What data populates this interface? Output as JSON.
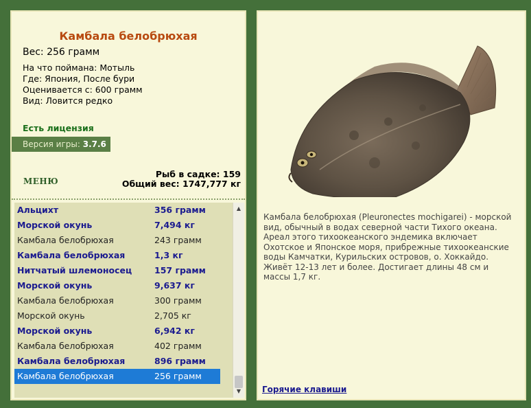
{
  "fish": {
    "name": "Камбала белобрюхая",
    "weight": "Вес: 256 грамм",
    "caught_on": "На что поймана: Мотыль",
    "where": "Где: Япония, После бури",
    "rated_from": "Оценивается с: 600 грамм",
    "kind": "Вид: Ловится редко"
  },
  "license": "Есть лицензия",
  "version": {
    "label": "Версия игры:",
    "number": "3.7.6"
  },
  "menu_label": "МЕНЮ",
  "stats": {
    "in_cage": "Рыб в садке: 159",
    "total_weight": "Общий вес: 1747,777 кг"
  },
  "catch_list": [
    {
      "name": "Альцихт",
      "weight": "356 грамм",
      "style": "bold"
    },
    {
      "name": "Морской окунь",
      "weight": "7,494 кг",
      "style": "bold"
    },
    {
      "name": "Камбала белобрюхая",
      "weight": "243 грамм",
      "style": "plain"
    },
    {
      "name": "Камбала белобрюхая",
      "weight": "1,3 кг",
      "style": "bold"
    },
    {
      "name": "Нитчатый шлемоносец",
      "weight": "157 грамм",
      "style": "bold"
    },
    {
      "name": "Морской окунь",
      "weight": "9,637 кг",
      "style": "bold"
    },
    {
      "name": "Камбала белобрюхая",
      "weight": "300 грамм",
      "style": "plain"
    },
    {
      "name": "Морской окунь",
      "weight": "2,705 кг",
      "style": "plain"
    },
    {
      "name": "Морской окунь",
      "weight": "6,942 кг",
      "style": "bold"
    },
    {
      "name": "Камбала белобрюхая",
      "weight": "402 грамм",
      "style": "plain"
    },
    {
      "name": "Камбала белобрюхая",
      "weight": "896 грамм",
      "style": "bold"
    },
    {
      "name": "Камбала белобрюхая",
      "weight": "256 грамм",
      "style": "selected"
    }
  ],
  "description": "Камбала белобрюхая (Pleuronectes mochigarei) - морской вид, обычный в водах северной части Тихого океана. Ареал этого тихоокеанского эндемика включает Охотское и Японское моря, прибрежные тихоокеанские воды Камчатки, Курильских островов, о. Хоккайдо. Живёт 12-13 лет и более. Достигает длины 48 см и массы 1,7 кг.",
  "hotkeys_label": "Горячие клавиши",
  "icons": {
    "scroll_up": "triangle-up",
    "scroll_down": "triangle-down"
  },
  "colors": {
    "background": "#44703a",
    "panel": "#f8f7da",
    "title": "#b84a10",
    "list_bold": "#1b1b8f",
    "selected": "#1e7bd6"
  }
}
